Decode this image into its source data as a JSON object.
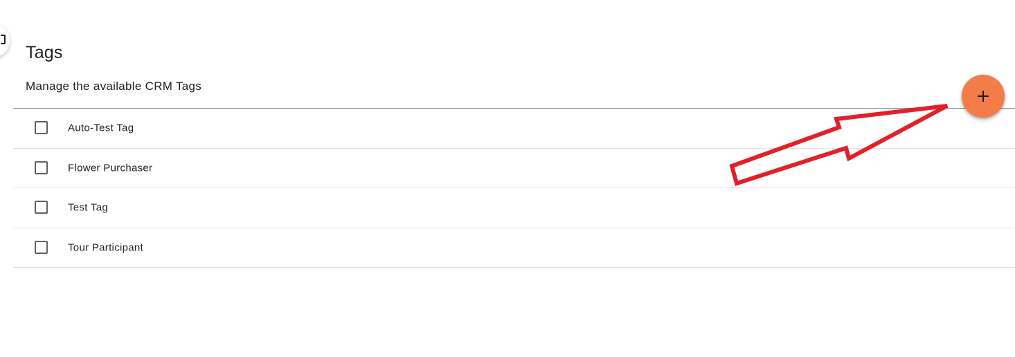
{
  "header": {
    "title": "Tags",
    "subtitle": "Manage the available CRM Tags"
  },
  "fab": {
    "icon": "plus-icon",
    "color": "#f47c48"
  },
  "tags": [
    {
      "label": "Auto-Test Tag",
      "checked": false
    },
    {
      "label": "Flower Purchaser",
      "checked": false
    },
    {
      "label": "Test Tag",
      "checked": false
    },
    {
      "label": "Tour Participant",
      "checked": false
    }
  ],
  "annotation": {
    "type": "arrow",
    "color": "#e3202a",
    "points_to": "add-tag-button"
  }
}
